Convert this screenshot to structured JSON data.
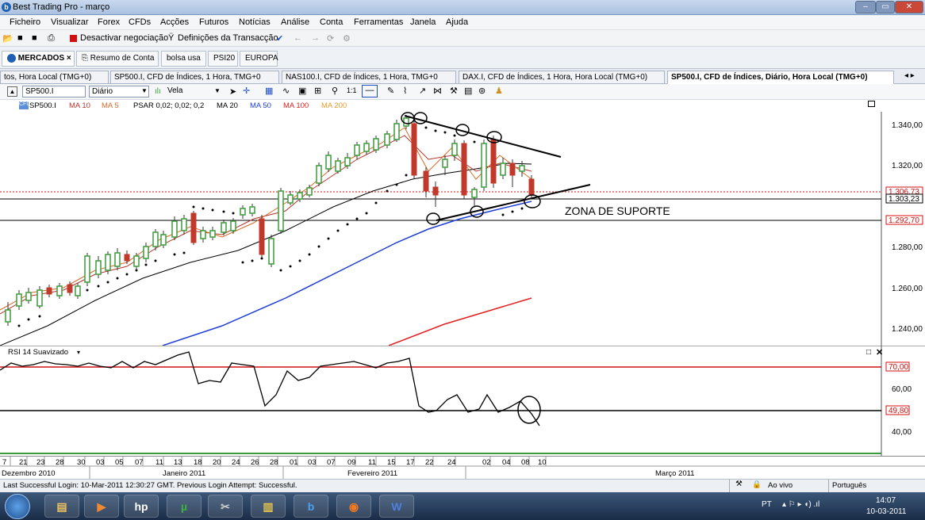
{
  "window": {
    "title": "Best Trading Pro - março",
    "app_icon": "b"
  },
  "menu": [
    "Ficheiro",
    "Visualizar",
    "Forex",
    "CFDs",
    "Acções",
    "Futuros",
    "Notícias",
    "Análise",
    "Conta",
    "Ferramentas",
    "Janela",
    "Ajuda"
  ],
  "toolbar": {
    "deactivate": "Desactivar negociação",
    "settings": "Definições da Transacção"
  },
  "main_tabs": [
    "MERCADOS",
    "Resumo de Conta",
    "bolsa usa",
    "PSI20",
    "EUROPA"
  ],
  "chart_tabs": [
    "tos, Hora Local (TMG+0)",
    "SP500.I, CFD de Índices, 1 Hora, TMG+0",
    "NAS100.I, CFD de Índices, 1 Hora, TMG+0",
    "DAX.I, CFD de Índices, 1 Hora, Hora Local (TMG+0)",
    "SP500.I, CFD de Índices, Diário, Hora Local (TMG+0)"
  ],
  "chart_toolbar": {
    "symbol": "SP500.I",
    "period": "Diário",
    "chart_type": "Vela"
  },
  "indicators": {
    "symbol": "SP500.I",
    "ma10": "MA 10",
    "ma5": "MA 5",
    "psar": "PSAR 0,02; 0,02; 0,2",
    "ma20": "MA 20",
    "ma50": "MA 50",
    "ma100": "MA 100",
    "ma200": "MA 200"
  },
  "price_axis": [
    "1.340,00",
    "1.320,00",
    "1.280,00",
    "1.260,00",
    "1.240,00"
  ],
  "price_tags": {
    "last": "1.306,73",
    "support_top": "1.303,23",
    "support_bottom": "1.292,70"
  },
  "annotation": "ZONA DE SUPORTE",
  "rsi": {
    "label": "RSI 14 Suavizado",
    "axis": [
      "60,00",
      "40,00"
    ],
    "levels": [
      "70,00",
      "49,80"
    ]
  },
  "date_ticks": [
    "7",
    "21",
    "23",
    "28",
    "30",
    "03",
    "05",
    "07",
    "11",
    "13",
    "18",
    "20",
    "24",
    "26",
    "28",
    "01",
    "03",
    "07",
    "09",
    "11",
    "15",
    "17",
    "22",
    "24",
    "02",
    "04",
    "08",
    "10"
  ],
  "months": [
    "Dezembro 2010",
    "Janeiro 2011",
    "Fevereiro 2011",
    "Março 2011"
  ],
  "status": {
    "login": "Last Successful Login: 10-Mar-2011 12:30:27 GMT. Previous Login Attempt: Successful.",
    "live": "Ao vivo",
    "lang": "Português"
  },
  "taskbar": {
    "lang": "PT",
    "time": "14:07",
    "date": "10-03-2011"
  },
  "colors": {
    "ma10": "#b5352a",
    "ma5": "#d46a2a",
    "ma20": "#000000",
    "ma50": "#1f3fd8",
    "ma100": "#e02020",
    "ma200": "#e59a2a",
    "bull": "#3c9a3c",
    "bear": "#c0392b"
  }
}
